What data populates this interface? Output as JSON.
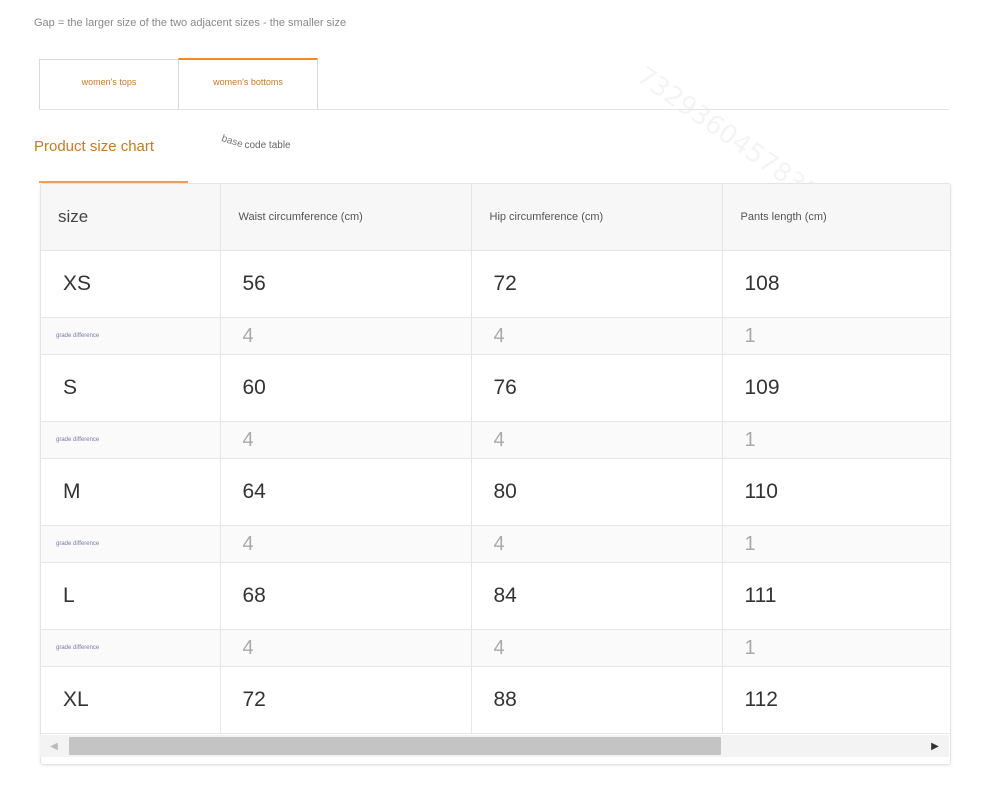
{
  "note": "Gap = the larger size of the two adjacent sizes - the smaller size",
  "tabs": [
    {
      "label": "women's tops"
    },
    {
      "label": "women's bottoms"
    }
  ],
  "subtabs": {
    "chart": "Product size chart",
    "code_prefix": "base",
    "code_suffix": "code table"
  },
  "table": {
    "headers": [
      "size",
      "Waist circumference (cm)",
      "Hip circumference (cm)",
      "Pants length (cm)"
    ],
    "rows": [
      {
        "type": "size",
        "cells": [
          "XS",
          "56",
          "72",
          "108"
        ]
      },
      {
        "type": "diff",
        "cells": [
          "grade difference",
          "4",
          "4",
          "1"
        ]
      },
      {
        "type": "size",
        "cells": [
          "S",
          "60",
          "76",
          "109"
        ]
      },
      {
        "type": "diff",
        "cells": [
          "grade difference",
          "4",
          "4",
          "1"
        ]
      },
      {
        "type": "size",
        "cells": [
          "M",
          "64",
          "80",
          "110"
        ]
      },
      {
        "type": "diff",
        "cells": [
          "grade difference",
          "4",
          "4",
          "1"
        ]
      },
      {
        "type": "size",
        "cells": [
          "L",
          "68",
          "84",
          "111"
        ]
      },
      {
        "type": "diff",
        "cells": [
          "grade difference",
          "4",
          "4",
          "1"
        ]
      },
      {
        "type": "size",
        "cells": [
          "XL",
          "72",
          "88",
          "112"
        ]
      }
    ]
  },
  "scrollbar": {
    "left_icon": "arrow-left-icon",
    "right_icon": "arrow-right-icon"
  },
  "watermark": "7329360457835",
  "colors": {
    "accent": "#f08a24",
    "tab_text": "#c27a2c"
  }
}
